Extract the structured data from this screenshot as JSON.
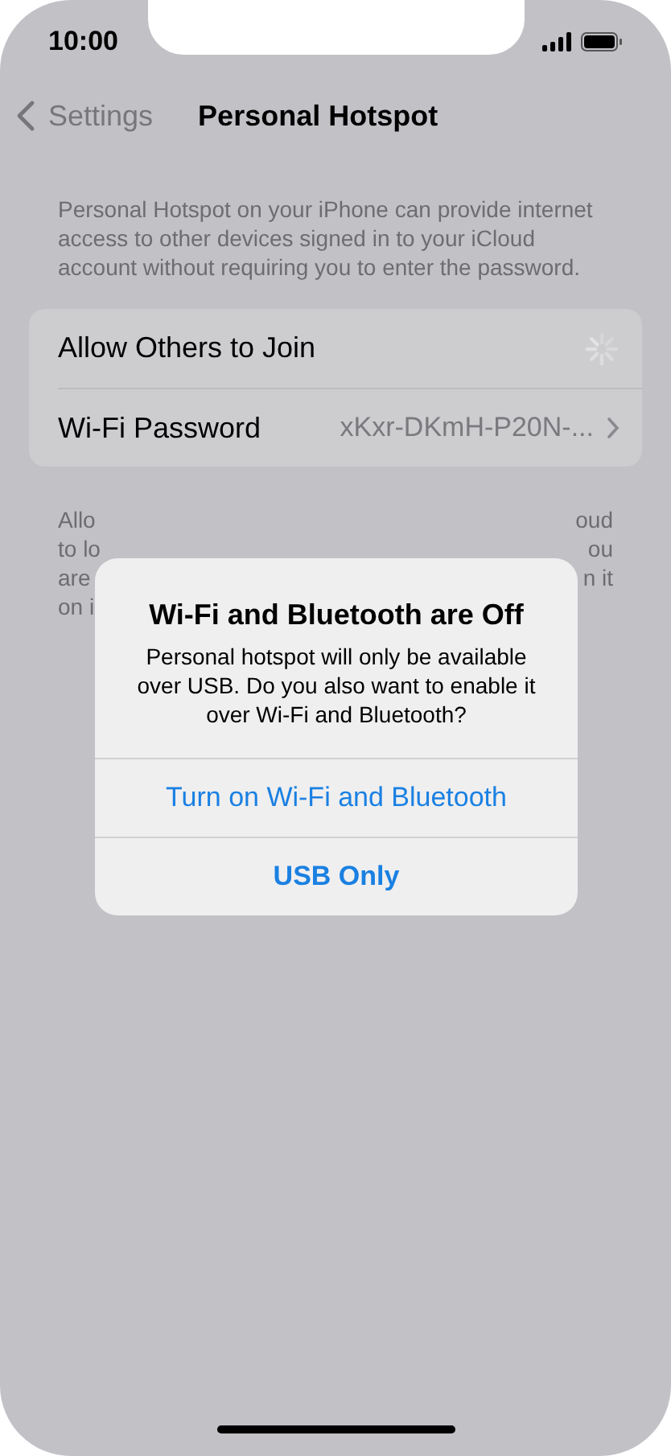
{
  "status_bar": {
    "time": "10:00"
  },
  "nav": {
    "back": "Settings",
    "title": "Personal Hotspot"
  },
  "intro": "Personal Hotspot on your iPhone can provide internet access to other devices signed in to your iCloud account without requiring you to enter the password.",
  "rows": [
    {
      "kind": "spinner",
      "label": "Allow Others to Join"
    },
    {
      "kind": "disclosure",
      "label": "Wi-Fi Password",
      "value": "xKxr-DKmH-P20N-..."
    }
  ],
  "footer_fragments": [
    {
      "left": "Allo",
      "right": "oud"
    },
    {
      "left": "to lo",
      "right": "ou"
    },
    {
      "left": "are",
      "right": "n it"
    },
    {
      "left": "on i"
    }
  ],
  "alert": {
    "title": "Wi-Fi and Bluetooth are Off",
    "message": "Personal hotspot will only be available over USB. Do you also want to enable it over Wi-Fi and Bluetooth?",
    "actions": [
      {
        "label": "Turn on Wi-Fi and Bluetooth",
        "bold": false
      },
      {
        "label": "USB Only",
        "bold": true
      }
    ]
  }
}
